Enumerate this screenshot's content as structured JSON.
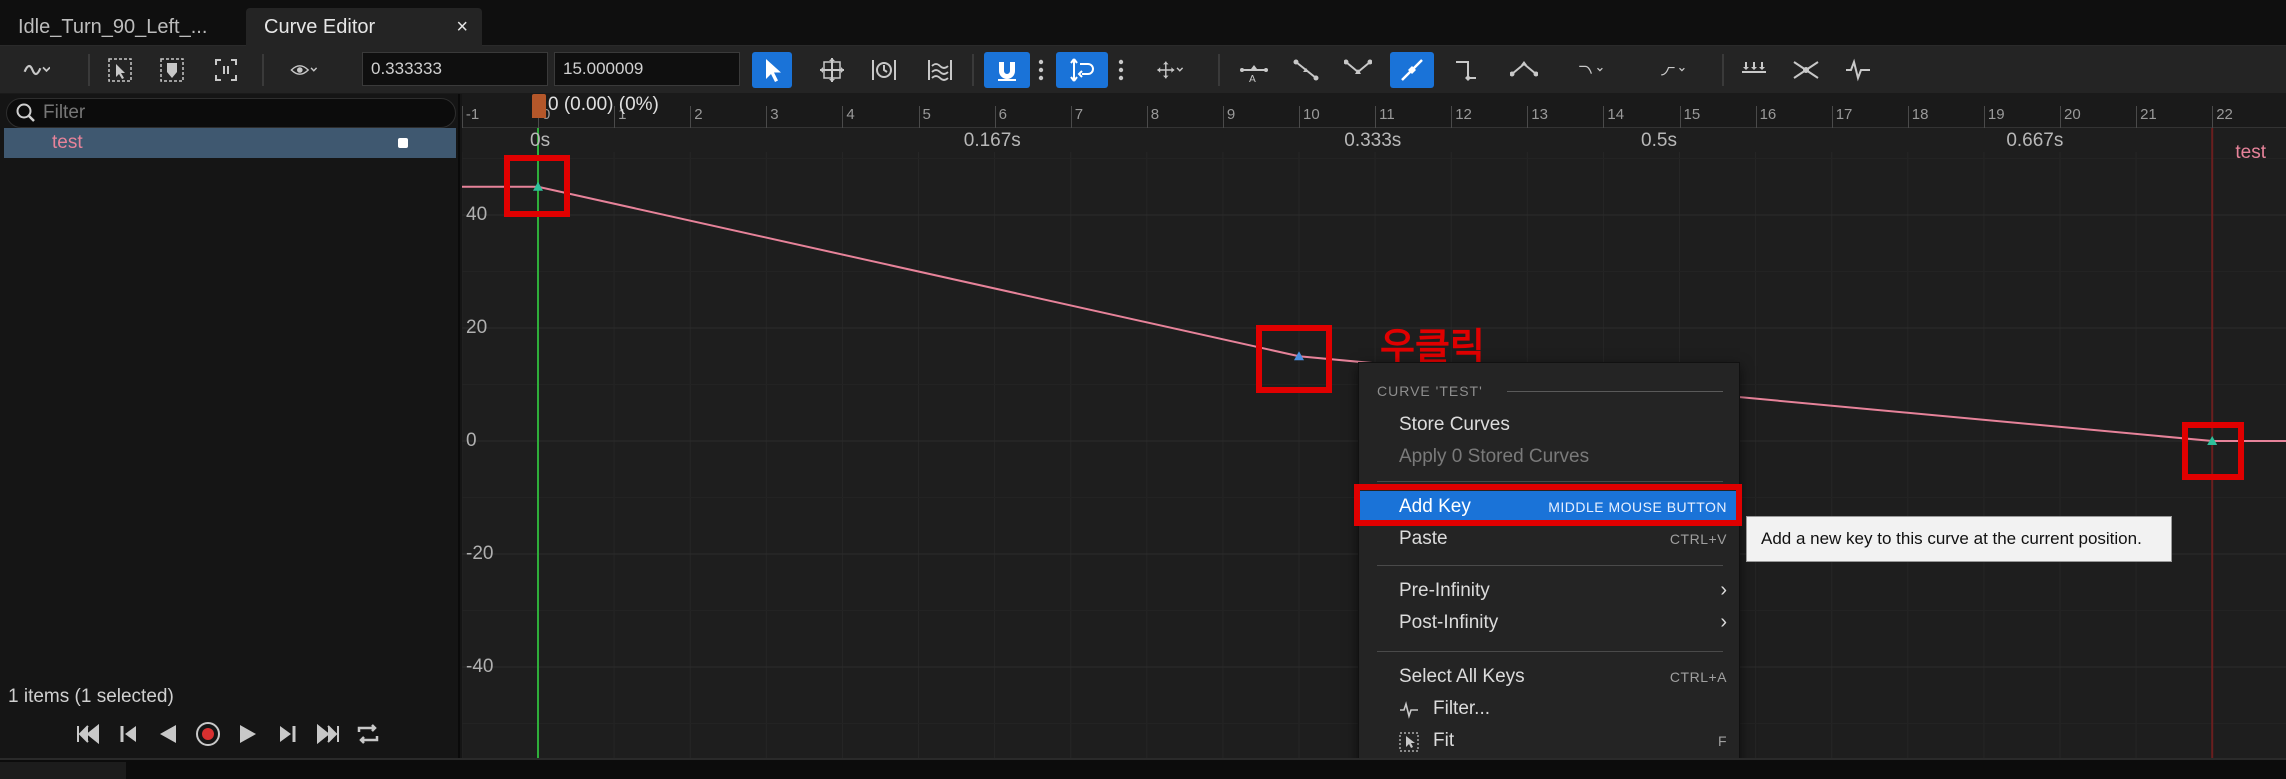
{
  "tabs": [
    {
      "label": "Idle_Turn_90_Left_..."
    },
    {
      "label": "Curve Editor",
      "close": "×"
    }
  ],
  "toolbar": {
    "time_value": "0.333333",
    "value_field": "15.000009"
  },
  "left_panel": {
    "filter_placeholder": "Filter",
    "tree_item": "test",
    "status": "1 items (1 selected)"
  },
  "graph": {
    "playhead_label": "0 (0.00) (0%)",
    "frame_ticks": [
      "-1",
      "0",
      "1",
      "2",
      "3",
      "4",
      "5",
      "6",
      "7",
      "8",
      "9",
      "10",
      "11",
      "12",
      "13",
      "14",
      "15",
      "16",
      "17",
      "18",
      "19",
      "20",
      "21",
      "22"
    ],
    "time_labels": [
      "0s",
      "0.167s",
      "0.333s",
      "0.5s",
      "0.667s"
    ],
    "y_labels": [
      "40",
      "20",
      "0",
      "-20",
      "-40"
    ],
    "curve_name": "test",
    "curve_color": "#e7839a",
    "keys": [
      {
        "frame": 0,
        "value": 45
      },
      {
        "frame": 10,
        "value": 15
      },
      {
        "frame": 22,
        "value": 0
      }
    ]
  },
  "annotation": {
    "korean_text": "우클릭",
    "color": "#e00000"
  },
  "context_menu": {
    "header": "CURVE 'TEST'",
    "items": {
      "store": {
        "label": "Store Curves"
      },
      "apply": {
        "label": "Apply 0 Stored Curves"
      },
      "add_key": {
        "label": "Add Key",
        "shortcut": "MIDDLE MOUSE BUTTON"
      },
      "paste": {
        "label": "Paste",
        "shortcut": "CTRL+V"
      },
      "pre_inf": {
        "label": "Pre-Infinity"
      },
      "post_inf": {
        "label": "Post-Infinity"
      },
      "select_all": {
        "label": "Select All Keys",
        "shortcut": "CTRL+A"
      },
      "filter": {
        "label": "Filter..."
      },
      "fit": {
        "label": "Fit",
        "shortcut": "F"
      }
    }
  },
  "tooltip": "Add a new key to this curve at the current position."
}
